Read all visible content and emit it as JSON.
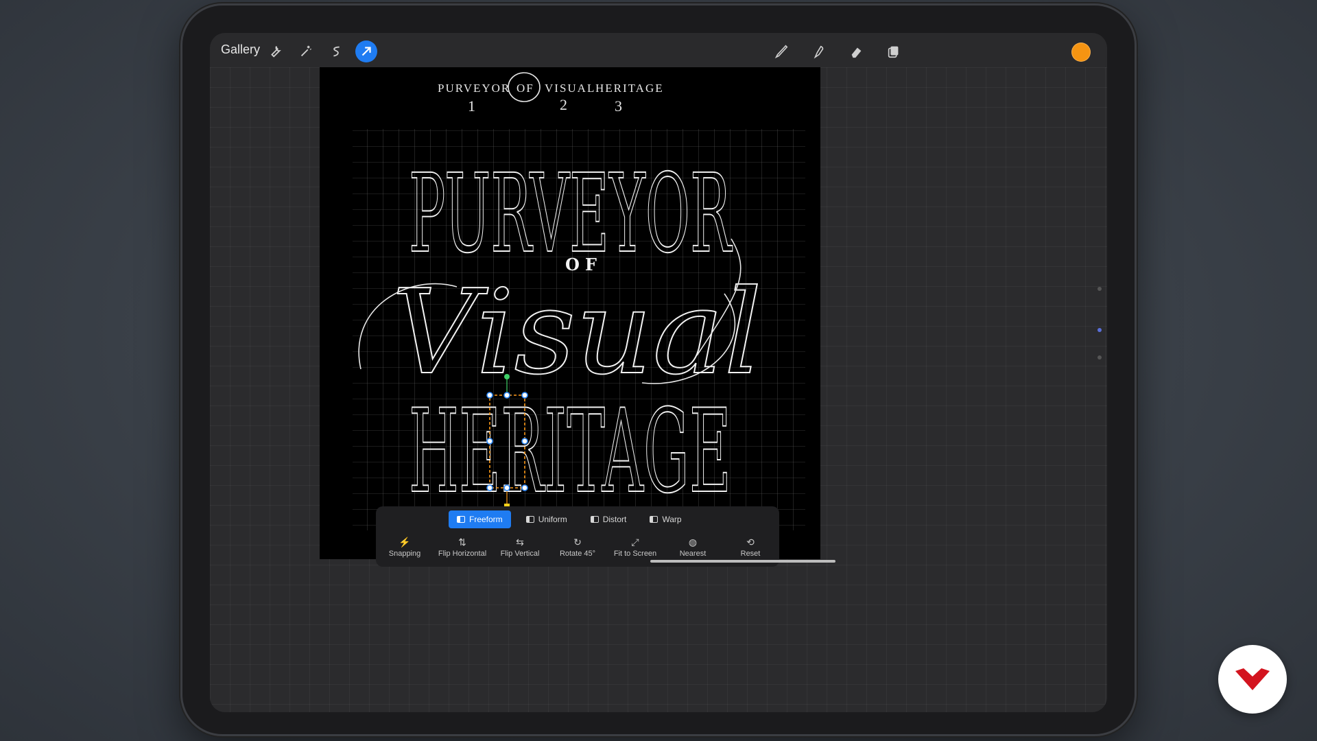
{
  "topbar": {
    "gallery_label": "Gallery",
    "tools_left": [
      "wrench-icon",
      "magic-wand-icon",
      "selection-icon",
      "transform-arrow-icon"
    ],
    "tools_right": [
      "brush-icon",
      "smudge-icon",
      "eraser-icon",
      "layers-icon"
    ],
    "active_color": "#f59412",
    "active_tool_color": "#1f7cf2"
  },
  "artwork": {
    "sketch_words": [
      "PURVEYOR",
      "OF",
      "VISUAL",
      "HERITAGE"
    ],
    "sketch_numbers": [
      "1",
      "2",
      "3"
    ],
    "line1": "PURVEYOR",
    "line2": "OF",
    "line3": "Visual",
    "line4": "HERITAGE"
  },
  "transform_panel": {
    "modes": [
      {
        "label": "Freeform",
        "active": true
      },
      {
        "label": "Uniform",
        "active": false
      },
      {
        "label": "Distort",
        "active": false
      },
      {
        "label": "Warp",
        "active": false
      }
    ],
    "actions": [
      {
        "label": "Snapping",
        "icon": "snapping-icon",
        "on": true
      },
      {
        "label": "Flip Horizontal",
        "icon": "flip-horizontal-icon",
        "on": false
      },
      {
        "label": "Flip Vertical",
        "icon": "flip-vertical-icon",
        "on": false
      },
      {
        "label": "Rotate 45°",
        "icon": "rotate-icon",
        "on": false
      },
      {
        "label": "Fit to Screen",
        "icon": "fit-screen-icon",
        "on": false
      },
      {
        "label": "Nearest",
        "icon": "nearest-icon",
        "on": false
      },
      {
        "label": "Reset",
        "icon": "reset-icon",
        "on": false
      }
    ]
  },
  "brand": {
    "icon": "brand-logo-icon",
    "color": "#d3141f"
  }
}
